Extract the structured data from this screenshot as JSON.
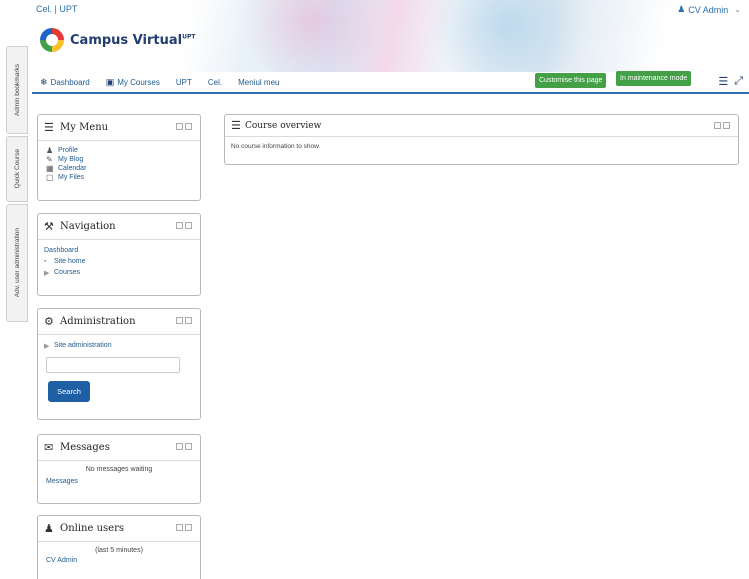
{
  "header": {
    "site_short": "Cel. | UPT",
    "logo_text": "Campus Virtual",
    "logo_sup": "UPT",
    "user_name": "CV Admin",
    "user_caret": "⌄"
  },
  "navbar": {
    "items": [
      {
        "label": "Dashboard",
        "icon": "dashboard-icon"
      },
      {
        "label": "My Courses",
        "icon": "courses-icon"
      },
      {
        "label": "UPT"
      },
      {
        "label": "Cel."
      },
      {
        "label": "Meniul meu"
      }
    ],
    "customise_label": "Customise this page",
    "maintenance_label": "In maintenance mode"
  },
  "side_tabs": [
    "Admin bookmarks",
    "Quick Course",
    "Adv. user administration"
  ],
  "blocks": {
    "my_menu": {
      "title": "My Menu",
      "items": [
        "Profile",
        "My Blog",
        "Calendar",
        "My Files"
      ]
    },
    "navigation": {
      "title": "Navigation",
      "dashboard": "Dashboard",
      "site_home": "Site home",
      "courses": "Courses"
    },
    "administration": {
      "title": "Administration",
      "site_admin": "Site administration",
      "search_placeholder": "",
      "search_button": "Search"
    },
    "messages": {
      "title": "Messages",
      "status": "No messages waiting",
      "link": "Messages"
    },
    "online_users": {
      "title": "Online users",
      "window": "(last 5 minutes)",
      "user": "CV Admin"
    }
  },
  "course_overview": {
    "title": "Course overview",
    "message": "No course information to show."
  },
  "colors": {
    "accent_blue": "#1f5fa3",
    "green": "#43a047",
    "nav_border": "#2f6fb3"
  }
}
